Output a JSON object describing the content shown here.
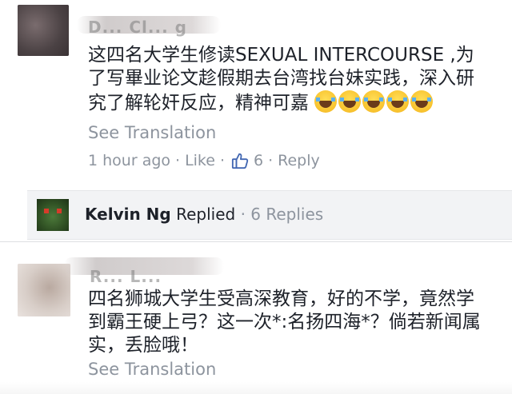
{
  "comments": [
    {
      "author_blurred": "D... Cl... g",
      "text": "这四名大学生修读SEXUAL INTERCOURSE ,为了写畢业论文趁假期去台湾找台妹实践，深入研究了解轮奸反应，精神可嘉",
      "emoji": [
        "face-with-tears-of-joy-icon",
        "face-with-tears-of-joy-icon",
        "face-with-tears-of-joy-icon",
        "face-with-tears-of-joy-icon",
        "face-with-tears-of-joy-icon"
      ],
      "translation_label": "See Translation",
      "time": "1 hour ago",
      "like_label": "Like",
      "like_count": "6",
      "reply_label": "Reply",
      "separator": "·"
    },
    {
      "author_blurred": "R... L...",
      "text": "四名狮城大学生受高深教育，好的不学，竟然学到霸王硬上弓？这一次*:名扬四海*？倘若新闻属实，丢脸哦！",
      "translation_label": "See Translation"
    }
  ],
  "reply_summary": {
    "name": "Kelvin Ng",
    "action": "Replied",
    "separator": "·",
    "count_label": "6 Replies"
  },
  "colors": {
    "text": "#1d2129",
    "secondary": "#8d949e",
    "like_blue": "#4267b2",
    "reply_bg": "#f2f3f5"
  }
}
